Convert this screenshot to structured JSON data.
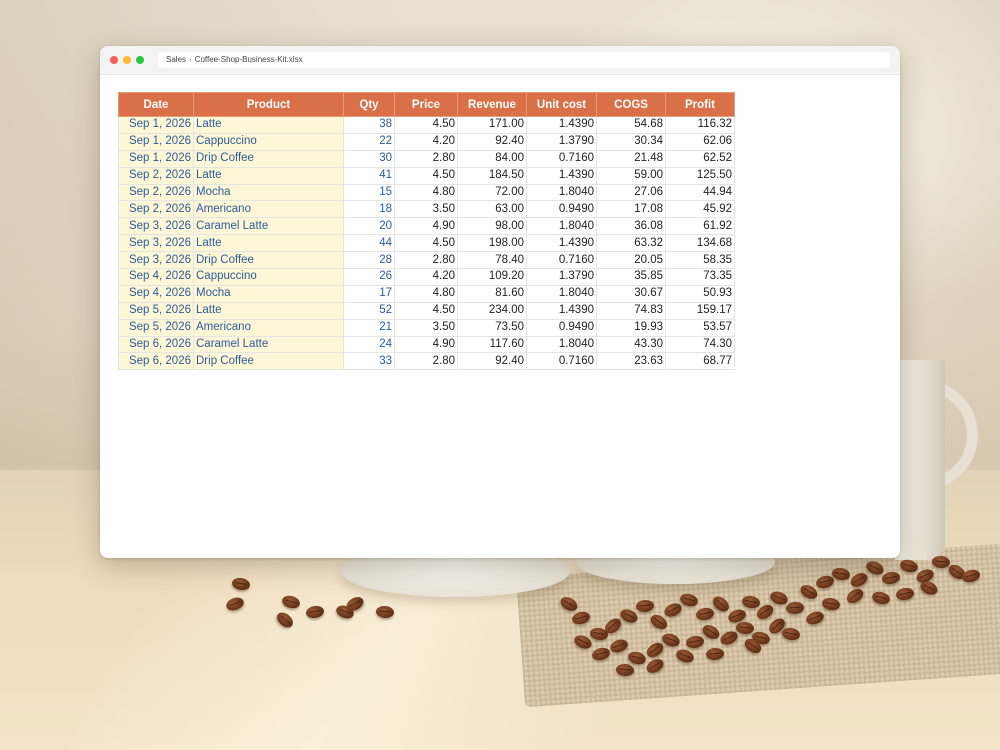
{
  "window": {
    "breadcrumb": [
      "Sales",
      "Coffee-Shop-Business-Kit.xlsx"
    ],
    "breadcrumb_separator": "›"
  },
  "table": {
    "headers": [
      "Date",
      "Product",
      "Qty",
      "Price",
      "Revenue",
      "Unit cost",
      "COGS",
      "Profit"
    ],
    "rows": [
      [
        "Sep 1, 2026",
        "Latte",
        "38",
        "4.50",
        "171.00",
        "1.4390",
        "54.68",
        "116.32"
      ],
      [
        "Sep 1, 2026",
        "Cappuccino",
        "22",
        "4.20",
        "92.40",
        "1.3790",
        "30.34",
        "62.06"
      ],
      [
        "Sep 1, 2026",
        "Drip Coffee",
        "30",
        "2.80",
        "84.00",
        "0.7160",
        "21.48",
        "62.52"
      ],
      [
        "Sep 2, 2026",
        "Latte",
        "41",
        "4.50",
        "184.50",
        "1.4390",
        "59.00",
        "125.50"
      ],
      [
        "Sep 2, 2026",
        "Mocha",
        "15",
        "4.80",
        "72.00",
        "1.8040",
        "27.06",
        "44.94"
      ],
      [
        "Sep 2, 2026",
        "Americano",
        "18",
        "3.50",
        "63.00",
        "0.9490",
        "17.08",
        "45.92"
      ],
      [
        "Sep 3, 2026",
        "Caramel Latte",
        "20",
        "4.90",
        "98.00",
        "1.8040",
        "36.08",
        "61.92"
      ],
      [
        "Sep 3, 2026",
        "Latte",
        "44",
        "4.50",
        "198.00",
        "1.4390",
        "63.32",
        "134.68"
      ],
      [
        "Sep 3, 2026",
        "Drip Coffee",
        "28",
        "2.80",
        "78.40",
        "0.7160",
        "20.05",
        "58.35"
      ],
      [
        "Sep 4, 2026",
        "Cappuccino",
        "26",
        "4.20",
        "109.20",
        "1.3790",
        "35.85",
        "73.35"
      ],
      [
        "Sep 4, 2026",
        "Mocha",
        "17",
        "4.80",
        "81.60",
        "1.8040",
        "30.67",
        "50.93"
      ],
      [
        "Sep 5, 2026",
        "Latte",
        "52",
        "4.50",
        "234.00",
        "1.4390",
        "74.83",
        "159.17"
      ],
      [
        "Sep 5, 2026",
        "Americano",
        "21",
        "3.50",
        "73.50",
        "0.9490",
        "19.93",
        "53.57"
      ],
      [
        "Sep 6, 2026",
        "Caramel Latte",
        "24",
        "4.90",
        "117.60",
        "1.8040",
        "43.30",
        "74.30"
      ],
      [
        "Sep 6, 2026",
        "Drip Coffee",
        "33",
        "2.80",
        "92.40",
        "0.7160",
        "23.63",
        "68.77"
      ]
    ]
  },
  "colors": {
    "header_bg": "#d97047",
    "header_text": "#ffffff",
    "key_column_bg": "#fdf7d8",
    "key_text": "#2d5c96"
  }
}
